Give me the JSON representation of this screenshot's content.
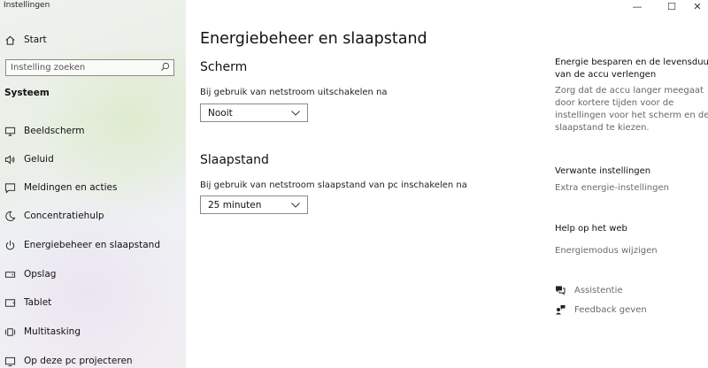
{
  "app": {
    "title": "Instellingen"
  },
  "window_controls": {
    "minimize": "—",
    "maximize": "☐",
    "close": "✕"
  },
  "sidebar": {
    "home_label": "Start",
    "search_placeholder": "Instelling zoeken",
    "section": "Systeem",
    "items": [
      {
        "label": "Beeldscherm",
        "icon": "monitor-icon"
      },
      {
        "label": "Geluid",
        "icon": "speaker-icon"
      },
      {
        "label": "Meldingen en acties",
        "icon": "notification-icon"
      },
      {
        "label": "Concentratiehulp",
        "icon": "moon-icon"
      },
      {
        "label": "Energiebeheer en slaapstand",
        "icon": "power-icon"
      },
      {
        "label": "Opslag",
        "icon": "storage-icon"
      },
      {
        "label": "Tablet",
        "icon": "tablet-icon"
      },
      {
        "label": "Multitasking",
        "icon": "multitasking-icon"
      },
      {
        "label": "Op deze pc projecteren",
        "icon": "project-icon"
      }
    ]
  },
  "main": {
    "title": "Energiebeheer en slaapstand",
    "screen": {
      "heading": "Scherm",
      "label": "Bij gebruik van netstroom uitschakelen na",
      "value": "Nooit"
    },
    "sleep": {
      "heading": "Slaapstand",
      "label": "Bij gebruik van netstroom slaapstand van pc inschakelen na",
      "value": "25 minuten"
    }
  },
  "right_panel": {
    "battery_heading_1": "Energie besparen en de levensduur",
    "battery_heading_2": "van de accu verlengen",
    "battery_text": [
      "Zorg dat de accu langer meegaat",
      "door kortere tijden voor de",
      "instellingen voor het scherm en de",
      "slaapstand te kiezen."
    ],
    "related_heading": "Verwante instellingen",
    "related_link": "Extra energie-instellingen",
    "help_heading": "Help op het web",
    "help_link": "Energiemodus wijzigen",
    "assist_label": "Assistentie",
    "feedback_label": "Feedback geven"
  }
}
